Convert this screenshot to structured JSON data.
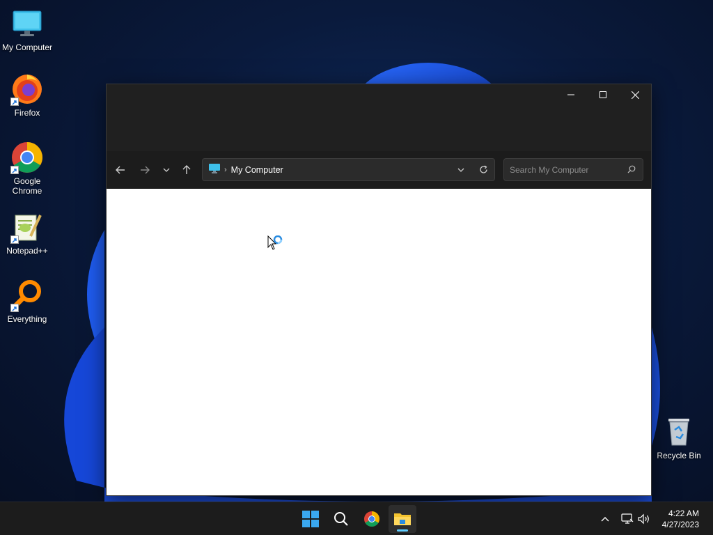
{
  "desktop": {
    "icons": [
      {
        "label": "My Computer"
      },
      {
        "label": "Firefox"
      },
      {
        "label": "Google Chrome"
      },
      {
        "label": "Notepad++"
      },
      {
        "label": "Everything"
      },
      {
        "label": "Recycle Bin"
      }
    ]
  },
  "window": {
    "address": {
      "location": "My Computer",
      "separator": "›"
    },
    "search": {
      "placeholder": "Search My Computer"
    }
  },
  "taskbar": {
    "items": [
      "start-icon",
      "search-icon",
      "chrome-icon",
      "file-explorer-icon"
    ],
    "active": "file-explorer-icon",
    "clock": {
      "time": "4:22 AM",
      "date": "4/27/2023"
    }
  },
  "colors": {
    "accent": "#60cdff",
    "window_bg": "#202020",
    "taskbar_bg": "#1c1c1c"
  }
}
